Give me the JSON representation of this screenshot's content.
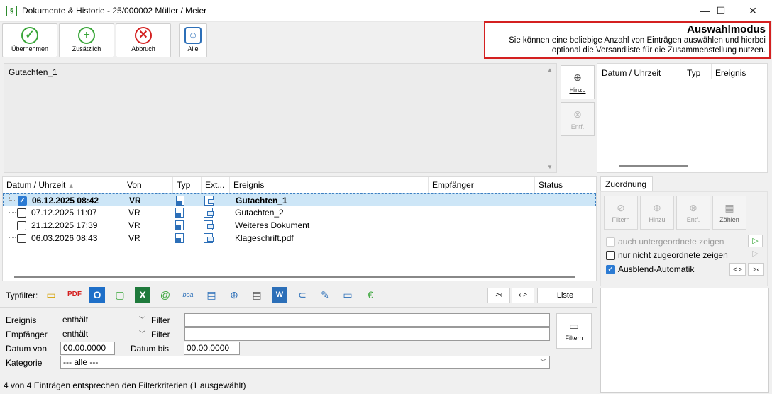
{
  "window": {
    "title": "Dokumente & Historie - 25/000002  Müller / Meier",
    "app_icon": "§"
  },
  "toolbar": {
    "accept_label": "Übernehmen",
    "additional_label": "Zusätzlich",
    "cancel_label": "Abbruch",
    "all_label": "Alle"
  },
  "hint": {
    "title": "Auswahlmodus",
    "line1": "Sie können eine beliebige Anzahl von Einträgen auswählen und hierbei",
    "line2": "optional die Versandliste für die Zusammenstellung nutzen."
  },
  "selection": {
    "item": "Gutachten_1",
    "add_label": "Hinzu",
    "remove_label": "Entf."
  },
  "right_pane": {
    "col_date": "Datum / Uhrzeit",
    "col_type": "Typ",
    "col_event": "Ereignis"
  },
  "table": {
    "headers": {
      "date": "Datum / Uhrzeit",
      "from": "Von",
      "type": "Typ",
      "ext": "Ext...",
      "event": "Ereignis",
      "recipient": "Empfänger",
      "status": "Status"
    },
    "rows": [
      {
        "checked": true,
        "date": "06.12.2025  08:42",
        "from": "VR",
        "event": "Gutachten_1"
      },
      {
        "checked": false,
        "date": "07.12.2025  11:07",
        "from": "VR",
        "event": "Gutachten_2"
      },
      {
        "checked": false,
        "date": "21.12.2025  17:39",
        "from": "VR",
        "event": "Weiteres Dokument"
      },
      {
        "checked": false,
        "date": "06.03.2026  08:43",
        "from": "VR",
        "event": "Klageschrift.pdf"
      }
    ]
  },
  "typfilter": {
    "label": "Typfilter:",
    "btn_collapse": ">‹",
    "btn_expand": "‹ >",
    "btn_list": "Liste"
  },
  "filters": {
    "event_label": "Ereignis",
    "event_mode": "enthält",
    "event_filter_label": "Filter",
    "event_value": "",
    "recipient_label": "Empfänger",
    "recipient_mode": "enthält",
    "recipient_filter_label": "Filter",
    "recipient_value": "",
    "date_from_label": "Datum von",
    "date_from": "00.00.0000",
    "date_to_label": "Datum bis",
    "date_to": "00.00.0000",
    "category_label": "Kategorie",
    "category": "--- alle ---",
    "filter_button": "Filtern"
  },
  "status": "4 von 4 Einträgen entsprechen den Filterkriterien (1 ausgewählt)",
  "zuordnung": {
    "tab": "Zuordnung",
    "btn_filter": "Filtern",
    "btn_add": "Hinzu",
    "btn_remove": "Entf.",
    "btn_count": "Zählen",
    "opt_sub": "auch untergeordnete zeigen",
    "opt_unassigned": "nur nicht zugeordnete zeigen",
    "opt_autohide": "Ausblend-Automatik",
    "btn_expand": "< >",
    "btn_collapse": ">‹"
  }
}
